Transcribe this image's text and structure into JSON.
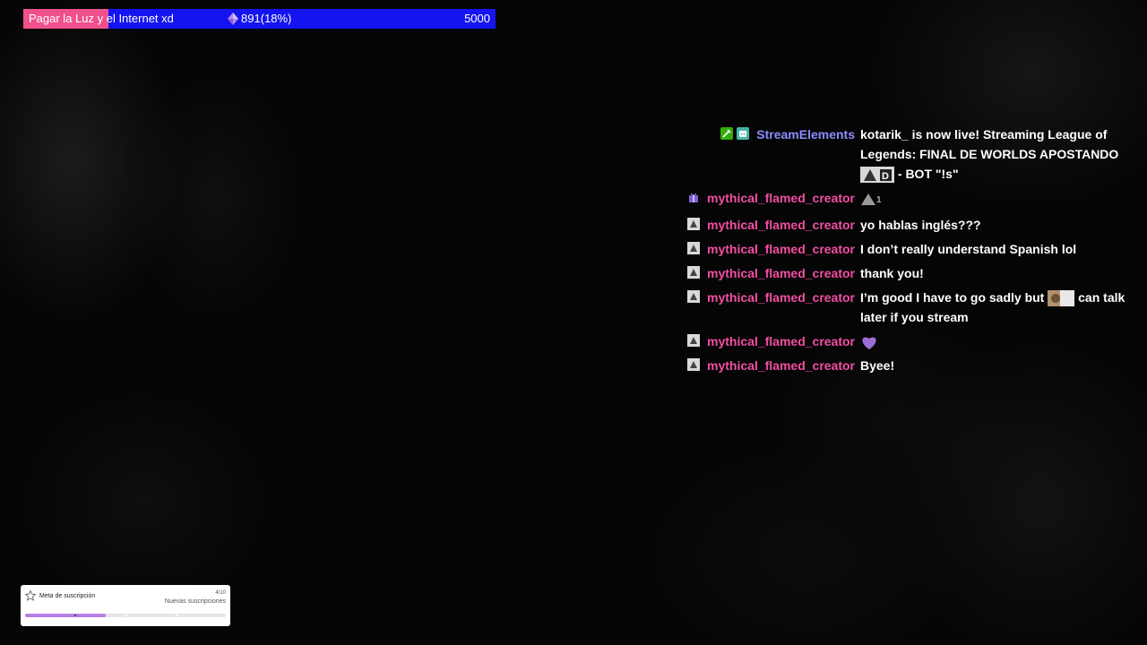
{
  "goal_bar": {
    "title": "Pagar la Luz y el Internet xd",
    "current": "891(18%)",
    "target": "5000",
    "progress": 0.18,
    "fill_color": "#f0508c",
    "bar_color": "#1414f0",
    "icon": "gem-icon"
  },
  "chat": {
    "messages": [
      {
        "user": "StreamElements",
        "user_color": "#8c8cff",
        "badges": [
          "moderator-badge-icon",
          "bot-badge-icon"
        ],
        "text": "kotarik_ is now live! Streaming League of Legends: FINAL DE WORLDS APOSTANDO",
        "text_after_emote": " - BOT \"!s\"",
        "has_emote": true
      },
      {
        "user": "mythical_flamed_creator",
        "user_color": "#f24fa3",
        "badges": [
          "sub-gift-badge-icon"
        ],
        "text": "",
        "emote_suffix": "1",
        "has_emote": true
      },
      {
        "user": "mythical_flamed_creator",
        "user_color": "#f24fa3",
        "badges": [
          "subscriber-badge-icon"
        ],
        "text": "yo hablas inglés???"
      },
      {
        "user": "mythical_flamed_creator",
        "user_color": "#f24fa3",
        "badges": [
          "subscriber-badge-icon"
        ],
        "text": "I don’t really understand Spanish lol"
      },
      {
        "user": "mythical_flamed_creator",
        "user_color": "#f24fa3",
        "badges": [
          "subscriber-badge-icon"
        ],
        "text": "thank you!"
      },
      {
        "user": "mythical_flamed_creator",
        "user_color": "#f24fa3",
        "badges": [
          "subscriber-badge-icon"
        ],
        "text": "I’m good I have to go sadly but",
        "text_after_emote": " can talk later if you stream",
        "has_emote": true
      },
      {
        "user": "mythical_flamed_creator",
        "user_color": "#f24fa3",
        "badges": [
          "subscriber-badge-icon"
        ],
        "text": "",
        "heart": true
      },
      {
        "user": "mythical_flamed_creator",
        "user_color": "#f24fa3",
        "badges": [
          "subscriber-badge-icon"
        ],
        "text": "Byee!"
      }
    ]
  },
  "sub_goal": {
    "title": "Meta de suscripción",
    "count": "4/10",
    "label": "Nuevas suscripciones",
    "progress": 0.4,
    "icon": "star-icon"
  }
}
